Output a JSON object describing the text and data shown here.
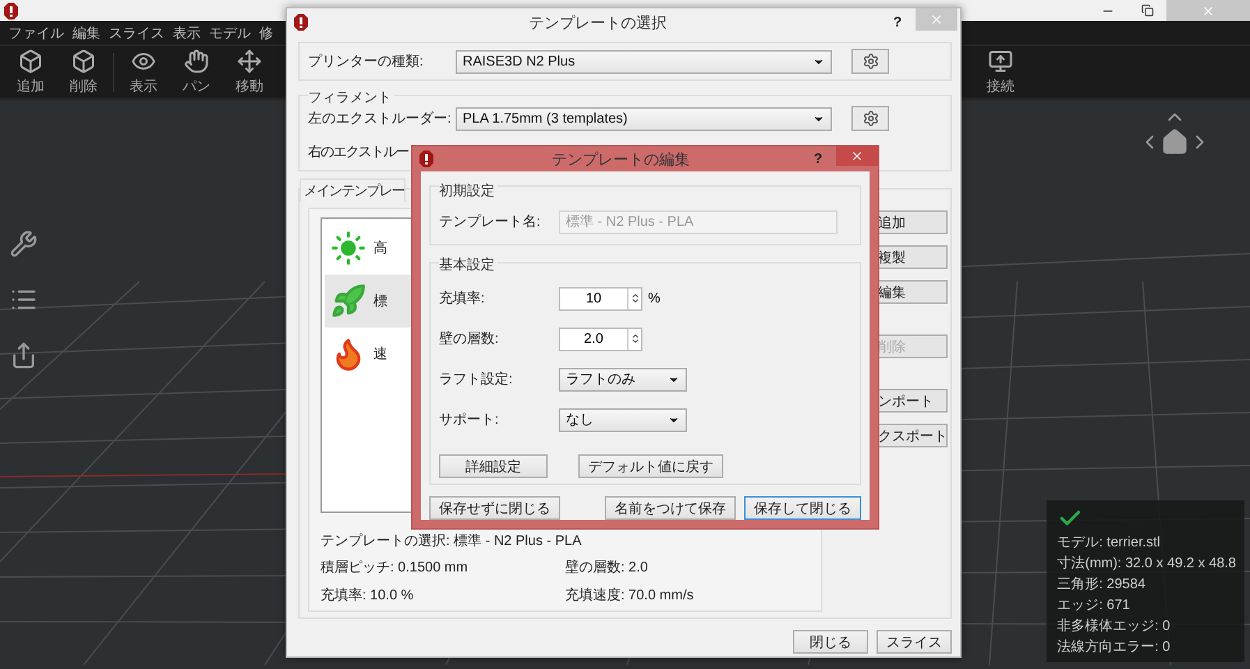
{
  "app": {
    "menu": [
      "ファイル",
      "編集",
      "スライス",
      "表示",
      "モデル",
      "修"
    ],
    "toolbar": [
      "追加",
      "削除",
      "表示",
      "パン",
      "移動"
    ],
    "toolbar_right": [
      "接続"
    ]
  },
  "model_info": {
    "lines": [
      "モデル: terrier.stl",
      "寸法(mm): 32.0 x 49.2 x 48.8",
      "三角形: 29584",
      "エッジ: 671",
      "非多様体エッジ: 0",
      "法線方向エラー: 0"
    ]
  },
  "template_dialog": {
    "title": "テンプレートの選択",
    "help": "?",
    "printer": {
      "label": "プリンターの種類:",
      "value": "RAISE3D N2 Plus"
    },
    "filament": {
      "title": "フィラメント",
      "extruders": [
        {
          "label": "左のエクストルーダー:",
          "value": "PLA 1.75mm (3 templates)"
        },
        {
          "label": "右のエクストルー"
        }
      ]
    },
    "templates": {
      "title": "メインテンプレー",
      "items": [
        {
          "label": "高",
          "selected": false
        },
        {
          "label": "標",
          "selected": true
        },
        {
          "label": "速",
          "selected": false
        }
      ],
      "buttons": [
        {
          "label": "追加",
          "disabled": false
        },
        {
          "label": "複製",
          "disabled": false
        },
        {
          "label": "編集",
          "disabled": false
        },
        {
          "label": "削除",
          "disabled": true
        },
        {
          "label": "ンポート",
          "disabled": false
        },
        {
          "label": "クスポート",
          "disabled": false
        }
      ],
      "selection": "テンプレートの選択: 標準 - N2 Plus - PLA",
      "details": [
        "積層ピッチ: 0.1500 mm",
        "壁の層数: 2.0",
        "充填率: 10.0 %",
        "充填速度: 70.0 mm/s"
      ]
    },
    "buttons": [
      "閉じる",
      "スライス"
    ]
  },
  "edit_dialog": {
    "title": "テンプレートの編集",
    "help": "?",
    "initial": {
      "title": "初期設定",
      "name_label": "テンプレート名:",
      "name_value": "標準 - N2 Plus - PLA"
    },
    "basic": {
      "title": "基本設定",
      "fields": [
        {
          "kind": "spin",
          "label": "充填率:",
          "value": "10",
          "unit": "%"
        },
        {
          "kind": "spin",
          "label": "壁の層数:",
          "value": "2.0"
        },
        {
          "kind": "select",
          "label": "ラフト設定:",
          "value": "ラフトのみ"
        },
        {
          "kind": "select",
          "label": "サポート:",
          "value": "なし"
        }
      ],
      "buttons": [
        "詳細設定",
        "デフォルト値に戻す"
      ]
    },
    "buttons": [
      {
        "label": "保存せずに閉じる",
        "default": false
      },
      {
        "label": "名前をつけて保存",
        "default": false
      },
      {
        "label": "保存して閉じる",
        "default": true
      }
    ]
  }
}
